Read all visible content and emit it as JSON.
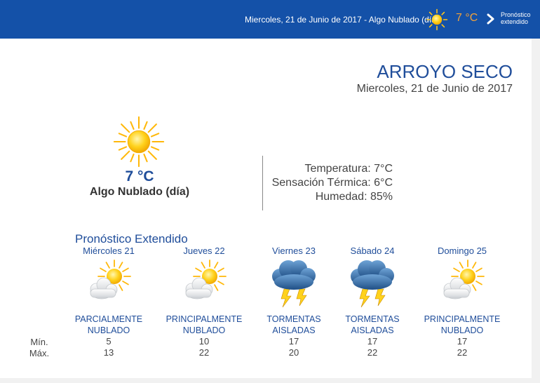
{
  "topbar": {
    "date_condition": "Miercoles, 21 de Junio de 2017 - Algo Nublado (día)",
    "temperature": "7 °C",
    "extended_link": [
      "Pronóstico",
      "extendido"
    ],
    "temp_color": "#f2a23a",
    "bar_color": "#1451a8"
  },
  "header": {
    "city": "ARROYO SECO",
    "date": "Miercoles, 21 de Junio de 2017"
  },
  "current": {
    "icon": "sun-icon",
    "temperature": "7 °C",
    "condition": "Algo Nublado (día)",
    "temperatura": "Temperatura: 7°C",
    "sensacion": "Sensación Térmica: 6°C",
    "humedad": "Humedad: 85%"
  },
  "extended": {
    "title": "Pronóstico Extendido",
    "min_label": "Mín.",
    "max_label": "Máx.",
    "days": [
      {
        "name": "Miércoles 21",
        "icon": "partly-cloudy-icon",
        "condition": [
          "PARCIALMENTE",
          "NUBLADO"
        ],
        "min": "5",
        "max": "13"
      },
      {
        "name": "Jueves 22",
        "icon": "partly-cloudy-icon",
        "condition": [
          "PRINCIPALMENTE",
          "NUBLADO"
        ],
        "min": "10",
        "max": "22"
      },
      {
        "name": "Viernes 23",
        "icon": "thunderstorm-icon",
        "condition": [
          "TORMENTAS",
          "AISLADAS"
        ],
        "min": "17",
        "max": "20"
      },
      {
        "name": "Sábado 24",
        "icon": "thunderstorm-icon",
        "condition": [
          "TORMENTAS",
          "AISLADAS"
        ],
        "min": "17",
        "max": "22"
      },
      {
        "name": "Domingo 25",
        "icon": "partly-cloudy-icon",
        "condition": [
          "PRINCIPALMENTE",
          "NUBLADO"
        ],
        "min": "17",
        "max": "22"
      }
    ]
  }
}
